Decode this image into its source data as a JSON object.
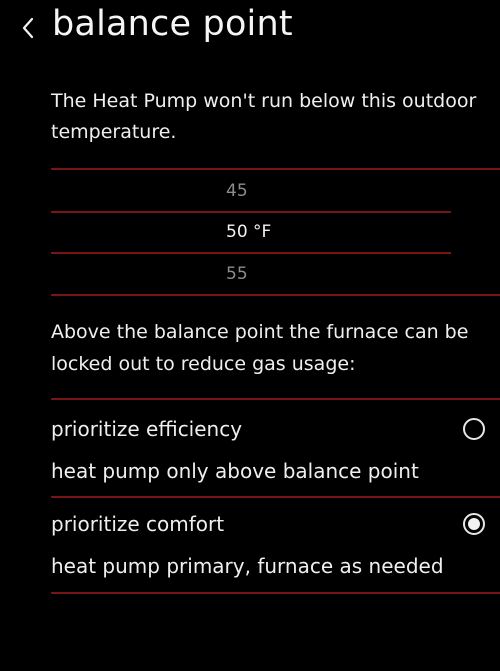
{
  "header": {
    "back_icon": "chevron-left-icon",
    "title": "balance point"
  },
  "description": "The Heat Pump won't run below this outdoor temperature.",
  "picker": {
    "prev": "45",
    "selected": "50 °F",
    "next": "55"
  },
  "lockout_description": "Above the balance point the furnace can be locked out to reduce gas usage:",
  "options": [
    {
      "title": "prioritize efficiency",
      "subtitle": "heat pump only above balance point",
      "selected": false
    },
    {
      "title": "prioritize comfort",
      "subtitle": "heat pump primary, furnace as needed",
      "selected": true
    }
  ],
  "colors": {
    "background": "#000000",
    "divider": "#7a1414",
    "text": "#f2f2f2",
    "dim_text": "#8c8c8c"
  }
}
